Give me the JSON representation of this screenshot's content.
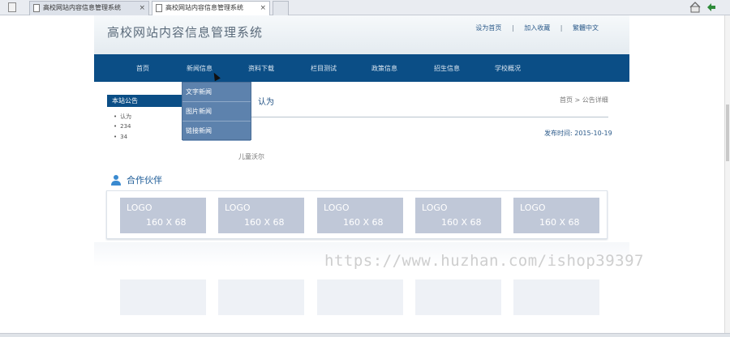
{
  "browser": {
    "tabs": [
      {
        "label": "高校网站内容信息管理系统",
        "close": "×"
      },
      {
        "label": "高校网站内容信息管理系统",
        "close": "×"
      }
    ]
  },
  "header": {
    "site_title": "高校网站内容信息管理系统",
    "links": [
      "设为首页",
      "加入收藏",
      "繁體中文"
    ],
    "separator": "|"
  },
  "nav": {
    "items": [
      "首页",
      "新闻信息",
      "资料下载",
      "栏目测试",
      "政策信息",
      "招生信息",
      "学校概况"
    ]
  },
  "dropdown": {
    "items": [
      "文字新闻",
      "图片新闻",
      "链接新闻"
    ]
  },
  "sidebar": {
    "title": "本站公告",
    "notices": [
      "认为",
      "234",
      "34"
    ]
  },
  "article": {
    "title": "认为",
    "breadcrumb": "首页 > 公告详细",
    "publish_date": "发布时间: 2015-10-19",
    "author": "儿童沃尔"
  },
  "partners": {
    "title": "合作伙伴",
    "logos": [
      {
        "line1": "LOGO",
        "line2": "160 X 68"
      },
      {
        "line1": "LOGO",
        "line2": "160 X 68"
      },
      {
        "line1": "LOGO",
        "line2": "160 X 68"
      },
      {
        "line1": "LOGO",
        "line2": "160 X 68"
      },
      {
        "line1": "LOGO",
        "line2": "160 X 68"
      }
    ]
  },
  "watermark": "https://www.huzhan.com/ishop39397",
  "colors": {
    "nav": "#0b4e86",
    "dropdown": "#5d82ad",
    "logo_placeholder": "#c0c8d8"
  }
}
